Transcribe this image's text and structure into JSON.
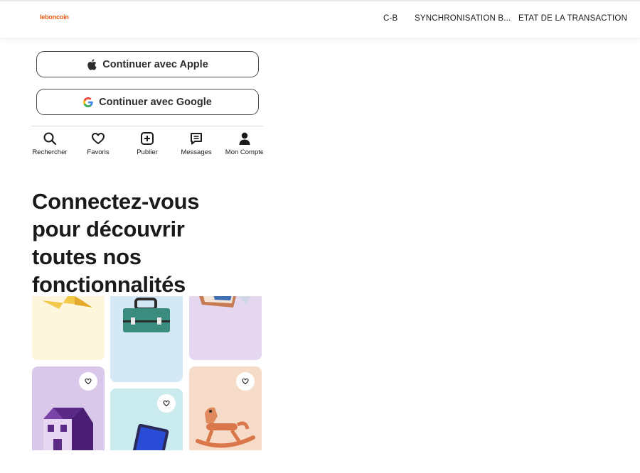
{
  "header": {
    "logo": "leboncoin",
    "nav": [
      "C-B",
      "SYNCHRONISATION B...",
      "ETAT DE LA TRANSACTION"
    ]
  },
  "auth": {
    "apple_label": "Continuer avec Apple",
    "google_label": "Continuer avec Google"
  },
  "tabbar": {
    "items": [
      {
        "label": "Rechercher",
        "icon": "search-icon"
      },
      {
        "label": "Favoris",
        "icon": "heart-icon"
      },
      {
        "label": "Publier",
        "icon": "plus-square-icon"
      },
      {
        "label": "Messages",
        "icon": "message-icon"
      },
      {
        "label": "Mon Compte",
        "icon": "user-icon"
      }
    ]
  },
  "headline": {
    "lines": [
      "Connectez-vous",
      "pour découvrir",
      "toutes nos",
      "fonctionnalités"
    ]
  },
  "colors": {
    "brand": "#ec5a13",
    "card_cream": "#fdf6dc",
    "card_blue": "#d4e8f5",
    "card_lavender": "#e4d7ef",
    "card_purple": "#d9c8ea",
    "card_aqua": "#cbecef",
    "card_peach": "#f6dcc8"
  }
}
